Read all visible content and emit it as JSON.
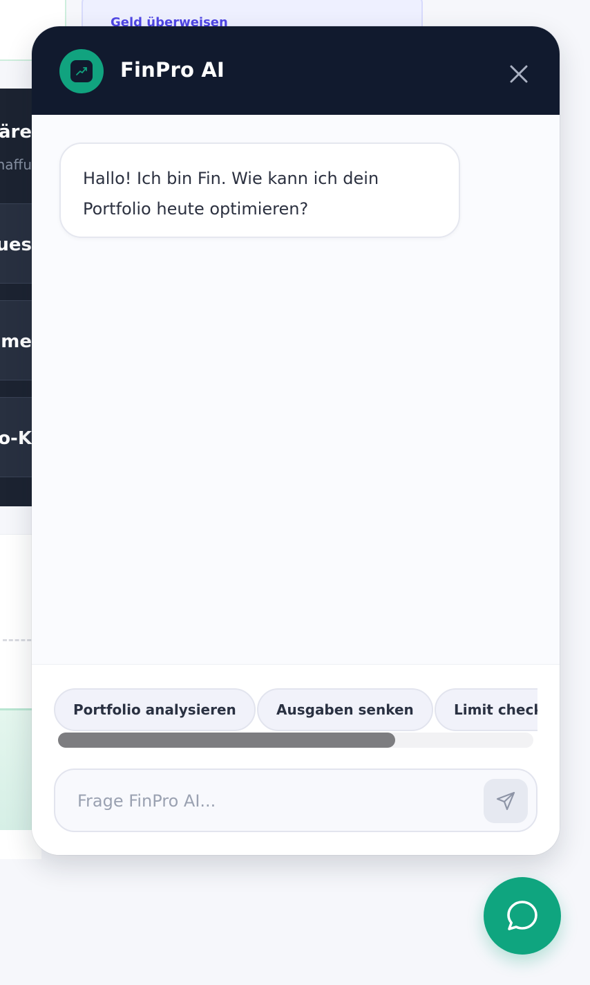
{
  "background": {
    "top_link": "Geld überweisen",
    "rows": [
      {
        "text": "wäre",
        "sub": "naffu"
      },
      {
        "text": "ues"
      },
      {
        "text": "mme"
      },
      {
        "text": "to-K"
      }
    ]
  },
  "chat": {
    "title": "FinPro AI",
    "messages": [
      {
        "role": "bot",
        "text": "Hallo! Ich bin Fin. Wie kann ich dein Portfolio heute optimieren?"
      }
    ],
    "suggestions": [
      "Portfolio analysieren",
      "Ausgaben senken",
      "Limit checken"
    ],
    "input": {
      "placeholder": "Frage FinPro AI...",
      "value": ""
    },
    "chips_scroll_fraction": 0.71
  },
  "icons": {
    "logo": "trend-chart-icon",
    "close": "close-icon",
    "send": "send-icon",
    "launcher": "chat-bubble-icon"
  },
  "colors": {
    "brand_green": "#0fa57f",
    "header_navy": "#111a2e",
    "link_indigo": "#4f46e5"
  }
}
